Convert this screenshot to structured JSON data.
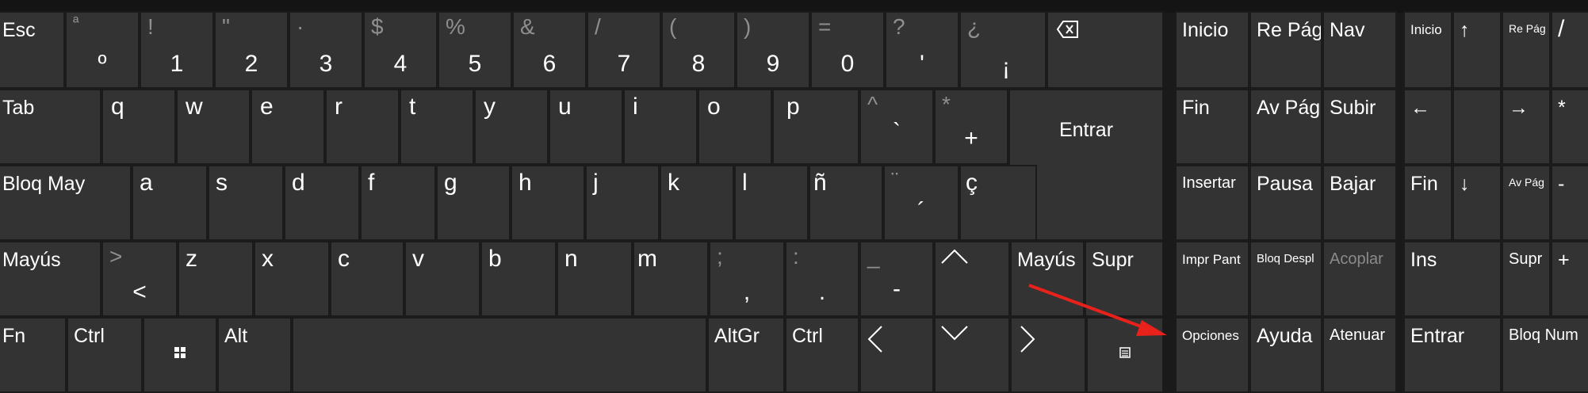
{
  "keyboard": {
    "alpha": {
      "row1": [
        {
          "main": "Esc",
          "type": "label"
        },
        {
          "shift": "ª",
          "main": "º"
        },
        {
          "shift": "!",
          "main": "1"
        },
        {
          "shift": "\"",
          "main": "2"
        },
        {
          "shift": "·",
          "main": "3"
        },
        {
          "shift": "$",
          "main": "4"
        },
        {
          "shift": "%",
          "main": "5"
        },
        {
          "shift": "&",
          "main": "6"
        },
        {
          "shift": "/",
          "main": "7"
        },
        {
          "shift": "(",
          "main": "8"
        },
        {
          "shift": ")",
          "main": "9"
        },
        {
          "shift": "=",
          "main": "0"
        },
        {
          "shift": "?",
          "main": "'"
        },
        {
          "shift": "¿",
          "main": "¡"
        },
        {
          "icon": "backspace-icon"
        }
      ],
      "row2": [
        {
          "main": "Tab",
          "type": "label"
        },
        {
          "main": "q"
        },
        {
          "main": "w"
        },
        {
          "main": "e"
        },
        {
          "main": "r"
        },
        {
          "main": "t"
        },
        {
          "main": "y"
        },
        {
          "main": "u"
        },
        {
          "main": "i"
        },
        {
          "main": "o"
        },
        {
          "main": "p"
        },
        {
          "shift": "^",
          "main": "`"
        },
        {
          "shift": "*",
          "main": "+"
        },
        {
          "main": "Entrar",
          "type": "enter"
        }
      ],
      "row3": [
        {
          "main": "Bloq May",
          "type": "label"
        },
        {
          "main": "a"
        },
        {
          "main": "s"
        },
        {
          "main": "d"
        },
        {
          "main": "f"
        },
        {
          "main": "g"
        },
        {
          "main": "h"
        },
        {
          "main": "j"
        },
        {
          "main": "k"
        },
        {
          "main": "l"
        },
        {
          "main": "ñ"
        },
        {
          "shift": "¨",
          "main": "´"
        },
        {
          "main": "ç"
        }
      ],
      "row4": [
        {
          "main": "Mayús",
          "type": "label"
        },
        {
          "shift": ">",
          "main": "<"
        },
        {
          "main": "z"
        },
        {
          "main": "x"
        },
        {
          "main": "c"
        },
        {
          "main": "v"
        },
        {
          "main": "b"
        },
        {
          "main": "n"
        },
        {
          "main": "m"
        },
        {
          "shift": ";",
          "main": ","
        },
        {
          "shift": ":",
          "main": "."
        },
        {
          "shift": "_",
          "main": "-"
        },
        {
          "icon": "arrow-up-icon"
        },
        {
          "main": "Mayús",
          "type": "label"
        },
        {
          "main": "Supr",
          "type": "label"
        }
      ],
      "row5": [
        {
          "main": "Fn",
          "type": "label"
        },
        {
          "main": "Ctrl",
          "type": "label"
        },
        {
          "icon": "windows-icon"
        },
        {
          "main": "Alt",
          "type": "label"
        },
        {
          "main": "",
          "type": "space"
        },
        {
          "main": "AltGr",
          "type": "label"
        },
        {
          "main": "Ctrl",
          "type": "label"
        },
        {
          "icon": "arrow-left-icon"
        },
        {
          "icon": "arrow-down-icon"
        },
        {
          "icon": "arrow-right-icon"
        },
        {
          "icon": "menu-icon"
        }
      ]
    },
    "nav": [
      [
        "Inicio",
        "Re Pág",
        "Nav"
      ],
      [
        "Fin",
        "Av Pág",
        "Subir"
      ],
      [
        "Insertar",
        "Pausa",
        "Bajar"
      ],
      [
        "Impr Pant",
        "Bloq Despl",
        "Acoplar"
      ],
      [
        "Opciones",
        "Ayuda",
        "Atenuar"
      ]
    ],
    "numpad": {
      "row1": [
        {
          "label": "Inicio",
          "sub": ""
        },
        {
          "icon": "↑"
        },
        {
          "label": "Re Pág"
        },
        {
          "label": "/"
        }
      ],
      "row2": [
        {
          "icon": "←"
        },
        {
          "label": ""
        },
        {
          "icon": "→"
        },
        {
          "label": "*"
        }
      ],
      "row3": [
        {
          "label": "Fin"
        },
        {
          "icon": "↓"
        },
        {
          "label": "Av Pág"
        },
        {
          "label": "-"
        }
      ],
      "row4": [
        {
          "label": "Ins"
        },
        {
          "label": "Supr"
        },
        {
          "label": "+"
        }
      ],
      "row5": [
        {
          "label": "Entrar"
        },
        {
          "label": "Bloq Num"
        }
      ]
    },
    "colors": {
      "key": "#333333",
      "gap": "#1b1b1b",
      "text": "#ffffff",
      "dim": "#8f8f8f",
      "annotation": "#e8221b"
    }
  }
}
